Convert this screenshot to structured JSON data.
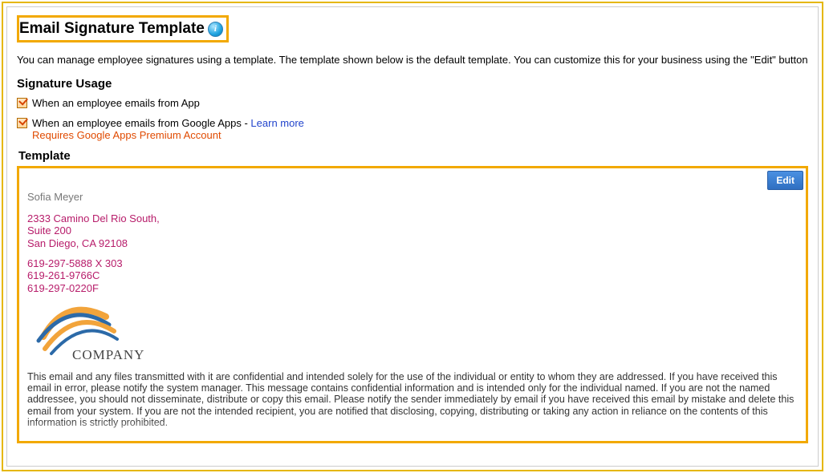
{
  "title": "Email Signature Template",
  "lead": "You can manage employee signatures using a template. The template shown below is the default template. You can customize this for your business using the \"Edit\" button",
  "usage": {
    "heading": "Signature Usage",
    "opt1_label": "When an employee emails from App",
    "opt2_prefix": "When an employee emails from Google Apps - ",
    "opt2_link": "Learn more",
    "opt2_note": "Requires Google Apps Premium Account"
  },
  "template_heading": "Template",
  "edit_label": "Edit",
  "signature": {
    "name": "Sofia Meyer",
    "addr_line1": "2333 Camino Del Rio South,",
    "addr_line2": "Suite 200",
    "addr_line3": "San Diego, CA 92108",
    "phone1": "619-297-5888 X 303",
    "phone2": "619-261-9766C",
    "phone3": "619-297-0220F",
    "logo_text": "COMPANY",
    "disclaimer": "This email and any files transmitted with it are confidential and intended solely for the use of the individual or entity to whom they are addressed. If you have received this email in error, please notify the system manager. This message contains confidential information and is intended only for the individual named. If you are not the named addressee, you should not disseminate, distribute or copy this email. Please notify the sender immediately by email if you have received this email by mistake and delete this email from your system. If you are not the intended recipient, you are notified that disclosing, copying, distributing or taking any action in reliance on the contents of this information is strictly prohibited."
  }
}
